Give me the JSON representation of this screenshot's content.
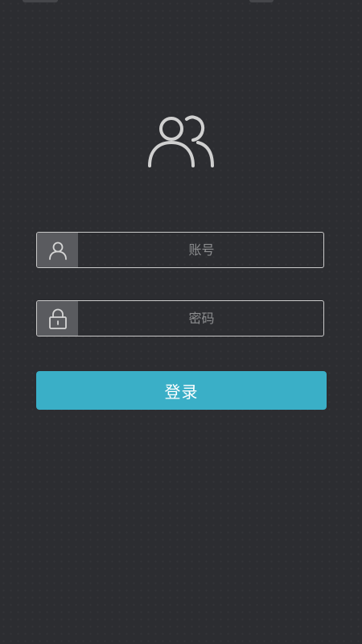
{
  "form": {
    "account": {
      "placeholder": "账号",
      "value": "",
      "icon": "user-icon"
    },
    "password": {
      "placeholder": "密码",
      "value": "",
      "icon": "lock-icon"
    },
    "login_label": "登录"
  },
  "colors": {
    "background": "#2c2d31",
    "accent": "#3aafc7",
    "field_border": "#c9c9c9",
    "icon_box": "#5a5b5f",
    "icon_stroke": "#d0d0d0"
  },
  "icons": {
    "logo": "users-icon"
  }
}
